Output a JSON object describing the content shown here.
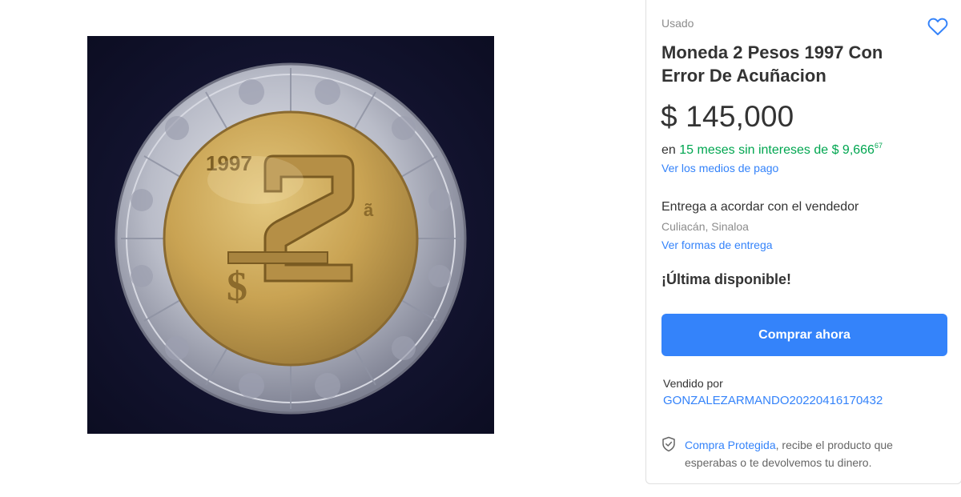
{
  "product_image": {
    "coin_year": "1997",
    "coin_value": "2"
  },
  "buy_box": {
    "condition": "Usado",
    "favorite_icon": "heart-icon",
    "title": "Moneda 2 Pesos 1997 Con Error De Acuñacion",
    "price": "$ 145,000",
    "installments": {
      "prefix": "en",
      "highlight": "15 meses sin intereses de $ 9,666",
      "cents": "67"
    },
    "payment_link": "Ver los medios de pago",
    "delivery": {
      "title": "Entrega a acordar con el vendedor",
      "location": "Culiacán, Sinaloa",
      "link": "Ver formas de entrega"
    },
    "stock": "¡Última disponible!",
    "buy_button": "Comprar ahora",
    "seller": {
      "label": "Vendido por",
      "name": "GONZALEZARMANDO20220416170432"
    },
    "protection": {
      "icon": "shield-check-icon",
      "link": "Compra Protegida",
      "text": ", recibe el producto que esperabas o te devolvemos tu dinero."
    }
  },
  "colors": {
    "accent": "#3483fa",
    "green": "#00a650",
    "text": "#333333",
    "muted": "#8c8c8c"
  }
}
